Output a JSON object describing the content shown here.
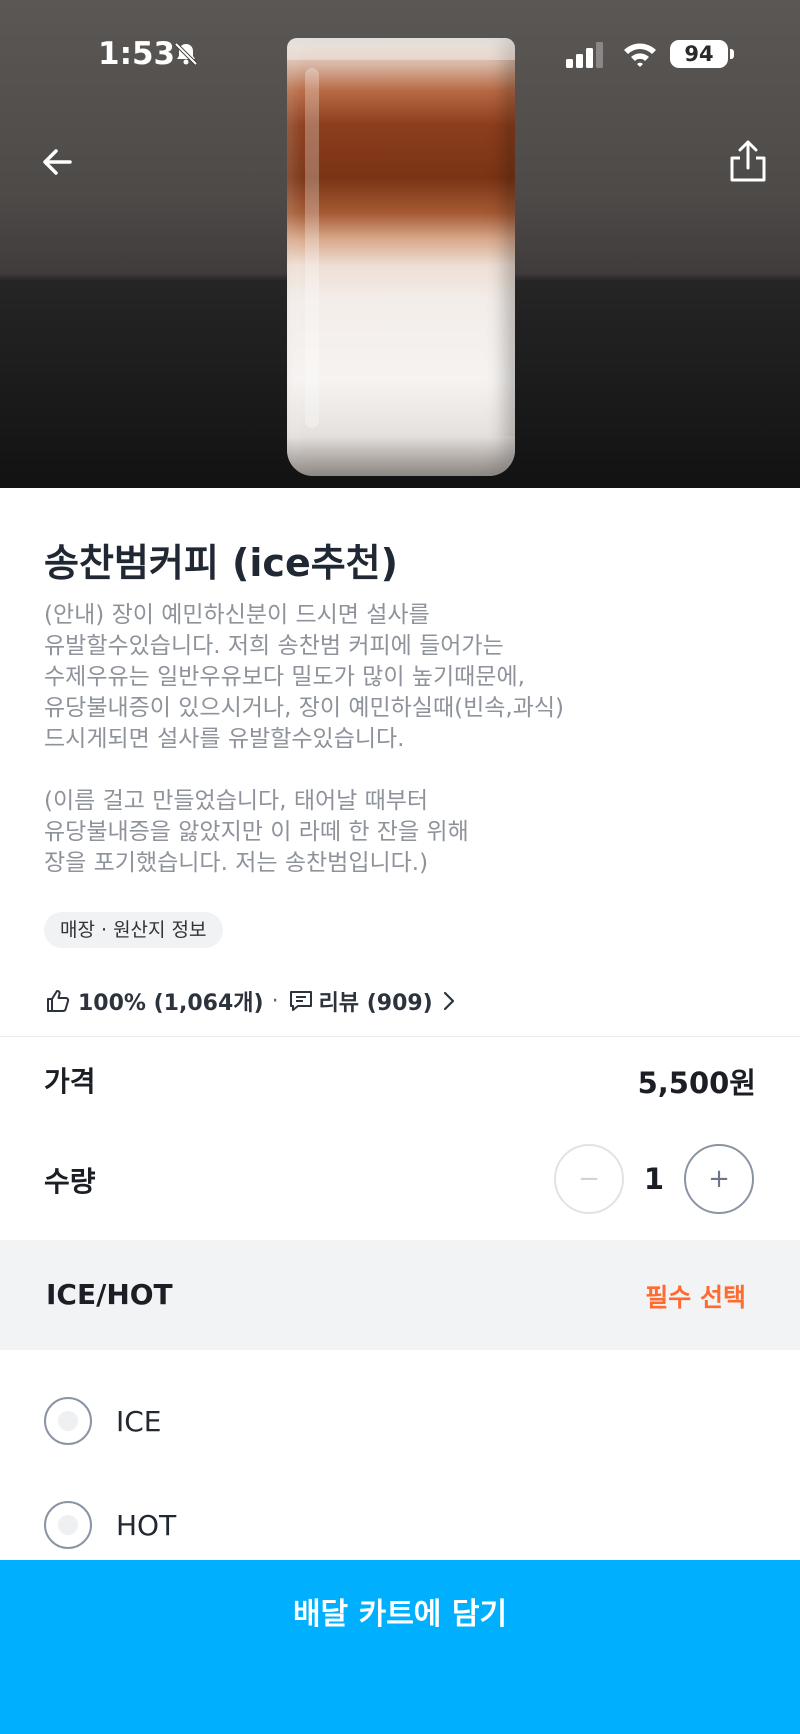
{
  "status_bar": {
    "time": "1:53",
    "battery": "94",
    "icons": [
      "bell-slash-icon",
      "signal-icon",
      "wifi-icon",
      "battery-icon"
    ]
  },
  "nav": {
    "back_icon": "arrow-left-icon",
    "share_icon": "share-icon"
  },
  "product": {
    "title": "송찬범커피 (ice추천)",
    "description": "(안내) 장이 예민하신분이 드시면 설사를\n유발할수있습니다. 저희 송찬범 커피에 들어가는\n수제우유는 일반우유보다 밀도가 많이 높기때문에,\n유당불내증이 있으시거나, 장이 예민하실때(빈속,과식)\n드시게되면 설사를 유발할수있습니다.\n\n(이름 걸고 만들었습니다, 태어날 때부터\n유당불내증을 앓았지만 이 라떼 한 잔을 위해\n장을 포기했습니다. 저는 송찬범입니다.)",
    "origin_chip": "매장 · 원산지 정보",
    "rating": "100% (1,064개)",
    "rating_separator": "·",
    "reviews": "리뷰 (909)"
  },
  "price": {
    "label": "가격",
    "value": "5,500원"
  },
  "quantity": {
    "label": "수량",
    "value": "1",
    "minus": "−",
    "plus": "+"
  },
  "option_group": {
    "title": "ICE/HOT",
    "required": "필수 선택",
    "options": [
      {
        "label": "ICE",
        "selected": false
      },
      {
        "label": "HOT",
        "selected": false
      }
    ]
  },
  "cart": {
    "button_label": "배달 카트에 담기"
  },
  "colors": {
    "accent": "#00b0ff",
    "required": "#ff6a2f"
  }
}
